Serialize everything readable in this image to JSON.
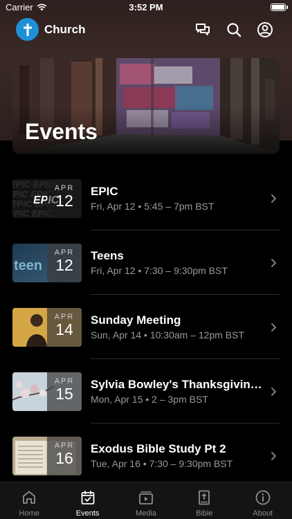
{
  "status_bar": {
    "carrier": "Carrier",
    "time": "3:52 PM"
  },
  "header": {
    "app_title": "Church",
    "icons": [
      "chat-icon",
      "search-icon",
      "profile-icon"
    ]
  },
  "hero": {
    "title": "Events"
  },
  "events": [
    {
      "title": "EPIC",
      "time": "Fri, Apr 12 • 5:45 – 7pm BST",
      "month": "APR",
      "day": "12",
      "thumb_text": "EPIC"
    },
    {
      "title": "Teens",
      "time": "Fri, Apr 12 • 7:30 – 9:30pm BST",
      "month": "APR",
      "day": "12",
      "thumb_text": "teen"
    },
    {
      "title": "Sunday Meeting",
      "time": "Sun, Apr 14 • 10:30am – 12pm BST",
      "month": "APR",
      "day": "14"
    },
    {
      "title": "Sylvia Bowley's Thanksgiving...",
      "time": "Mon, Apr 15 • 2 – 3pm BST",
      "month": "APR",
      "day": "15"
    },
    {
      "title": "Exodus Bible Study Pt 2",
      "time": "Tue, Apr 16 • 7:30 – 9:30pm BST",
      "month": "APR",
      "day": "16"
    }
  ],
  "tabs": [
    {
      "label": "Home",
      "icon": "home-icon",
      "active": false
    },
    {
      "label": "Events",
      "icon": "calendar-check-icon",
      "active": true
    },
    {
      "label": "Media",
      "icon": "media-play-icon",
      "active": false
    },
    {
      "label": "Bible",
      "icon": "bible-icon",
      "active": false
    },
    {
      "label": "About",
      "icon": "info-icon",
      "active": false
    }
  ],
  "colors": {
    "accent": "#1f8fd8",
    "background": "#000000",
    "secondary_text": "#9a9a9e"
  }
}
